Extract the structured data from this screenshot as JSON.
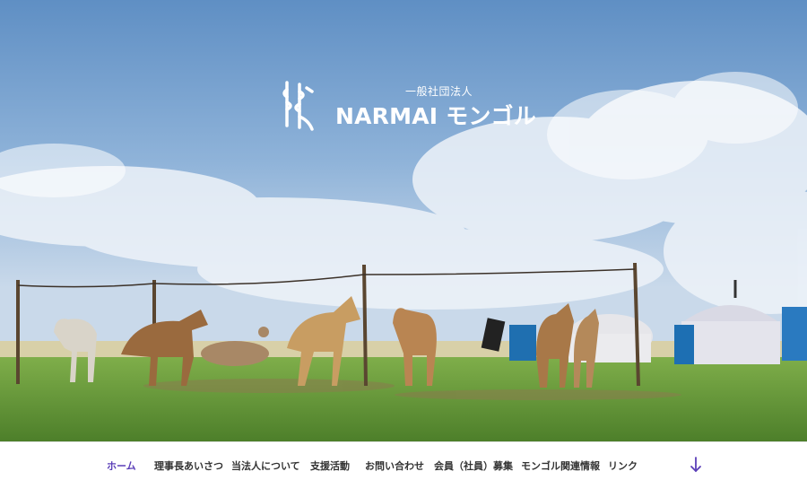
{
  "header": {
    "org_type": "一般社団法人",
    "org_name": "NARMAI モンゴル",
    "logo_icon": "mongolian-script-logo-icon"
  },
  "nav": {
    "items": [
      {
        "label": "ホーム",
        "active": true
      },
      {
        "label": "理事長あいさつ",
        "active": false
      },
      {
        "label": "当法人について",
        "active": false
      },
      {
        "label": "支援活動",
        "active": false
      },
      {
        "label": "お問い合わせ",
        "active": false
      },
      {
        "label": "会員（社員）募集",
        "active": false
      },
      {
        "label": "モンゴル関連情報",
        "active": false
      },
      {
        "label": "リンク",
        "active": false
      }
    ],
    "scroll_icon": "arrow-down-icon"
  },
  "colors": {
    "active_nav": "#5b3fb8",
    "nav_text": "#333333",
    "sky": "#7fa6cf",
    "grass": "#6a9a3a"
  }
}
